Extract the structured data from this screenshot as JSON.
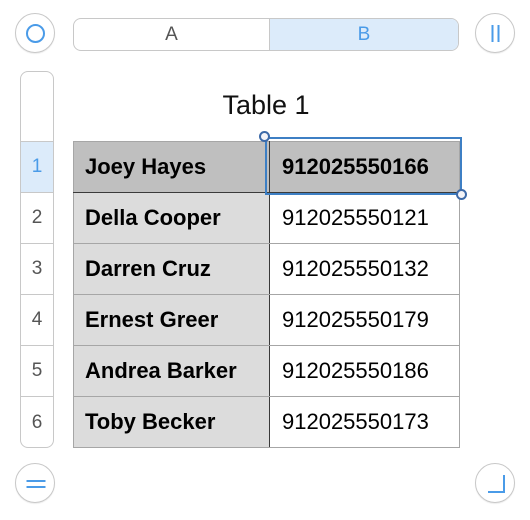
{
  "toolbar": {
    "top_left_icon": "circle-icon",
    "top_right_icon": "pause-icon",
    "bottom_left_icon": "equals-icon",
    "bottom_right_icon": "corner-resize-icon"
  },
  "columns": [
    {
      "label": "A",
      "selected": false
    },
    {
      "label": "B",
      "selected": true
    }
  ],
  "rows": [
    {
      "label": "1",
      "selected": true
    },
    {
      "label": "2",
      "selected": false
    },
    {
      "label": "3",
      "selected": false
    },
    {
      "label": "4",
      "selected": false
    },
    {
      "label": "5",
      "selected": false
    },
    {
      "label": "6",
      "selected": false
    }
  ],
  "table": {
    "title": "Table 1",
    "cells": [
      {
        "name": "Joey Hayes",
        "phone": "912025550166"
      },
      {
        "name": "Della Cooper",
        "phone": "912025550121"
      },
      {
        "name": "Darren Cruz",
        "phone": "912025550132"
      },
      {
        "name": "Ernest Greer",
        "phone": "912025550179"
      },
      {
        "name": "Andrea Barker",
        "phone": "912025550186"
      },
      {
        "name": "Toby Becker",
        "phone": "912025550173"
      }
    ],
    "selected_cell": "B1"
  },
  "colors": {
    "accent": "#4a9be8",
    "selection_fill": "#dcebfa",
    "selection_border": "#3d7fc4",
    "header_row_fill": "#bfbfbf",
    "name_column_fill": "#dcdcdc"
  }
}
